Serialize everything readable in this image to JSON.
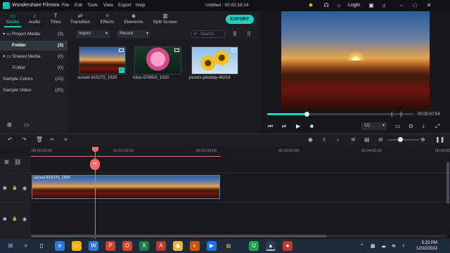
{
  "titlebar": {
    "app_name": "Wondershare Filmora",
    "menu": [
      "File",
      "Edit",
      "Tools",
      "View",
      "Export",
      "Help"
    ],
    "doc_title": "Untitled : 00:02:18:14",
    "login": "Login"
  },
  "toolbar": {
    "tabs": [
      {
        "label": "Media",
        "icon": "folder-icon"
      },
      {
        "label": "Audio",
        "icon": "music-note-icon"
      },
      {
        "label": "Titles",
        "icon": "text-icon"
      },
      {
        "label": "Transition",
        "icon": "transition-icon"
      },
      {
        "label": "Effects",
        "icon": "effects-icon"
      },
      {
        "label": "Elements",
        "icon": "elements-icon"
      },
      {
        "label": "Split Screen",
        "icon": "split-screen-icon"
      }
    ],
    "export_label": "EXPORT"
  },
  "left_panel": {
    "items": [
      {
        "label": "Project Media",
        "count": "(3)"
      },
      {
        "label": "Folder",
        "count": "(3)"
      },
      {
        "label": "Shared Media",
        "count": "(0)"
      },
      {
        "label": "Folder",
        "count": "(0)"
      },
      {
        "label": "Sample Colors",
        "count": "(15)"
      },
      {
        "label": "Sample Video",
        "count": "(20)"
      }
    ]
  },
  "media": {
    "import_label": "Import",
    "record_label": "Record",
    "search_placeholder": "Search",
    "items": [
      {
        "caption": "sunset-815270_1920"
      },
      {
        "caption": "lotus-978659_1920"
      },
      {
        "caption": "pexels-pixabay-46216"
      }
    ]
  },
  "preview": {
    "time": "00:00:47:04",
    "ratio": "1/2",
    "progress_fraction": 0.27
  },
  "timeline": {
    "ticks": [
      "00:00:00:00",
      "00:01:00:00",
      "00:02:00:00",
      "00:03:00:00",
      "00:04:00:00",
      "00:05:00:00"
    ],
    "clip_label": "sunset-815270_1920"
  },
  "taskbar": {
    "time": "5:22 PM",
    "date": "12/22/2022"
  },
  "colors": {
    "accent": "#1fd1c1",
    "playhead": "#ff6b6b"
  }
}
